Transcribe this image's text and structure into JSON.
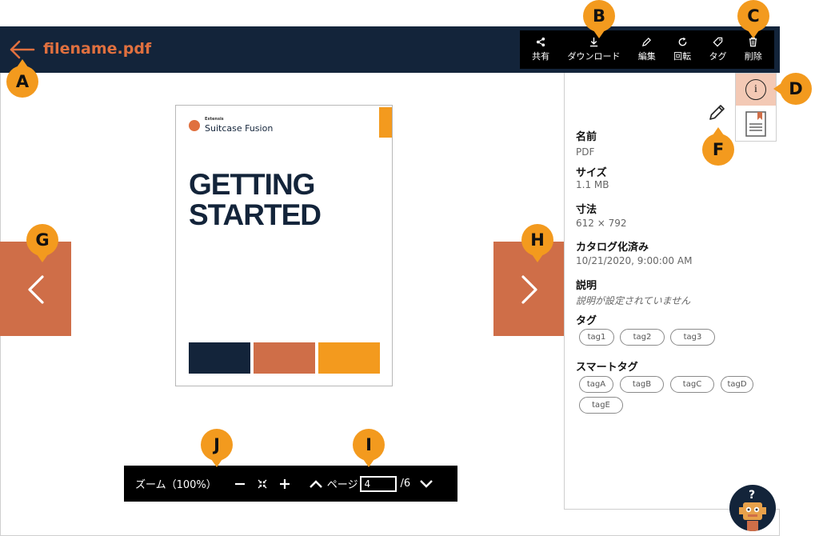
{
  "header": {
    "filename": "filename.pdf"
  },
  "toolbar": {
    "share": "共有",
    "download": "ダウンロード",
    "edit": "編集",
    "rotate": "回転",
    "tag": "タグ",
    "delete": "削除"
  },
  "badges": {
    "a": "A",
    "b": "B",
    "c": "C",
    "d": "D",
    "f": "F",
    "g": "G",
    "h": "H",
    "i": "I",
    "j": "J"
  },
  "document": {
    "brand_small": "Extensis",
    "brand": "Suitcase Fusion",
    "title_line1": "GETTING",
    "title_line2": "STARTED",
    "swatch_colors": [
      "#13243a",
      "#cf6e48",
      "#f39a1e"
    ]
  },
  "zoom": {
    "label": "ズーム（100%）",
    "page_label": "ページ",
    "page_value": "4",
    "page_total": "/6"
  },
  "info": {
    "name_label": "名前",
    "name_value": "PDF",
    "size_label": "サイズ",
    "size_value": "1.1 MB",
    "dim_label": "寸法",
    "dim_value": "612 × 792",
    "catalog_label": "カタログ化済み",
    "catalog_value": "10/21/2020, 9:00:00 AM",
    "desc_label": "説明",
    "desc_value": "説明が設定されていません",
    "tags_label": "タグ",
    "tags": [
      "tag1",
      "tag2",
      "tag3"
    ],
    "smart_label": "スマートタグ",
    "smart_tags": [
      "tagA",
      "tagB",
      "tagC",
      "tagD",
      "tagE"
    ]
  },
  "colors": {
    "header_bg": "#13243a",
    "accent_orange": "#e0703f",
    "nav_orange": "#cf6e48",
    "badge_yellow": "#f39a1e",
    "info_tab_bg": "#f3c9b5"
  },
  "icons": [
    "back-arrow-icon",
    "share-icon",
    "download-icon",
    "edit-icon",
    "rotate-icon",
    "tag-icon",
    "trash-icon",
    "info-icon",
    "notes-icon",
    "pencil-icon",
    "chevron-left-icon",
    "chevron-right-icon",
    "minus-icon",
    "fit-icon",
    "plus-icon",
    "chevron-up-icon",
    "chevron-down-icon",
    "help-icon"
  ]
}
